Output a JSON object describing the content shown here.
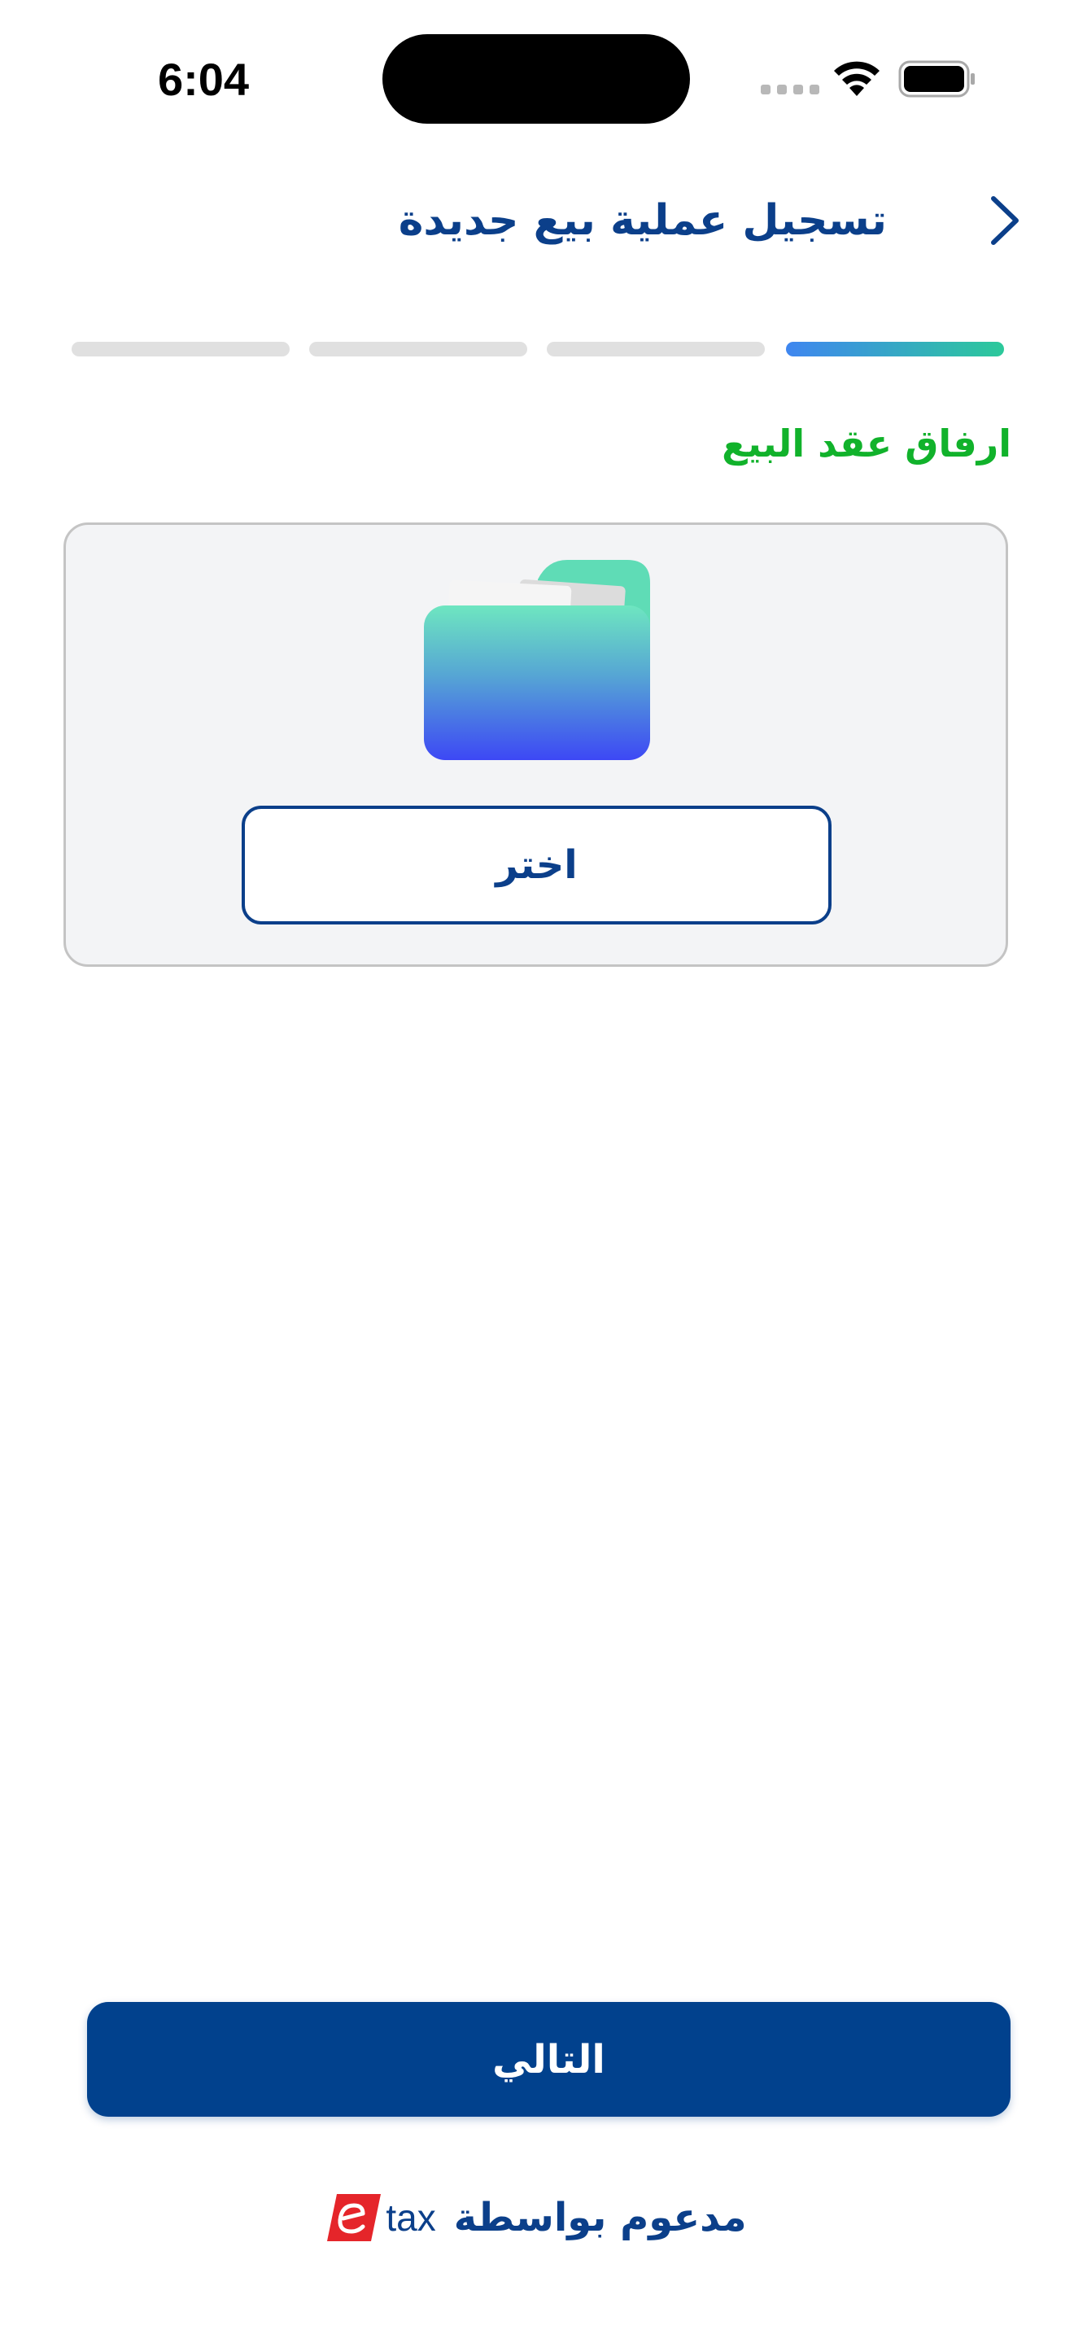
{
  "status_bar": {
    "time": "6:04"
  },
  "header": {
    "title": "تسجيل عملية بيع جديدة"
  },
  "progress": {
    "total_steps": 4,
    "current_step": 1
  },
  "section": {
    "label": "ارفاق عقد البيع"
  },
  "upload": {
    "choose_label": "اختر"
  },
  "actions": {
    "next_label": "التالي"
  },
  "footer": {
    "powered_by": "مدعوم بواسطة",
    "brand_text": "tax"
  },
  "colors": {
    "primary": "#01418d",
    "title": "#0b3f8a",
    "success_label": "#11b22b",
    "progress_active_start": "#3f86f0",
    "progress_active_end": "#2cc99a",
    "progress_inactive": "#e0e0e0",
    "card_background": "#f3f4f6",
    "etax_red": "#e5252a"
  }
}
